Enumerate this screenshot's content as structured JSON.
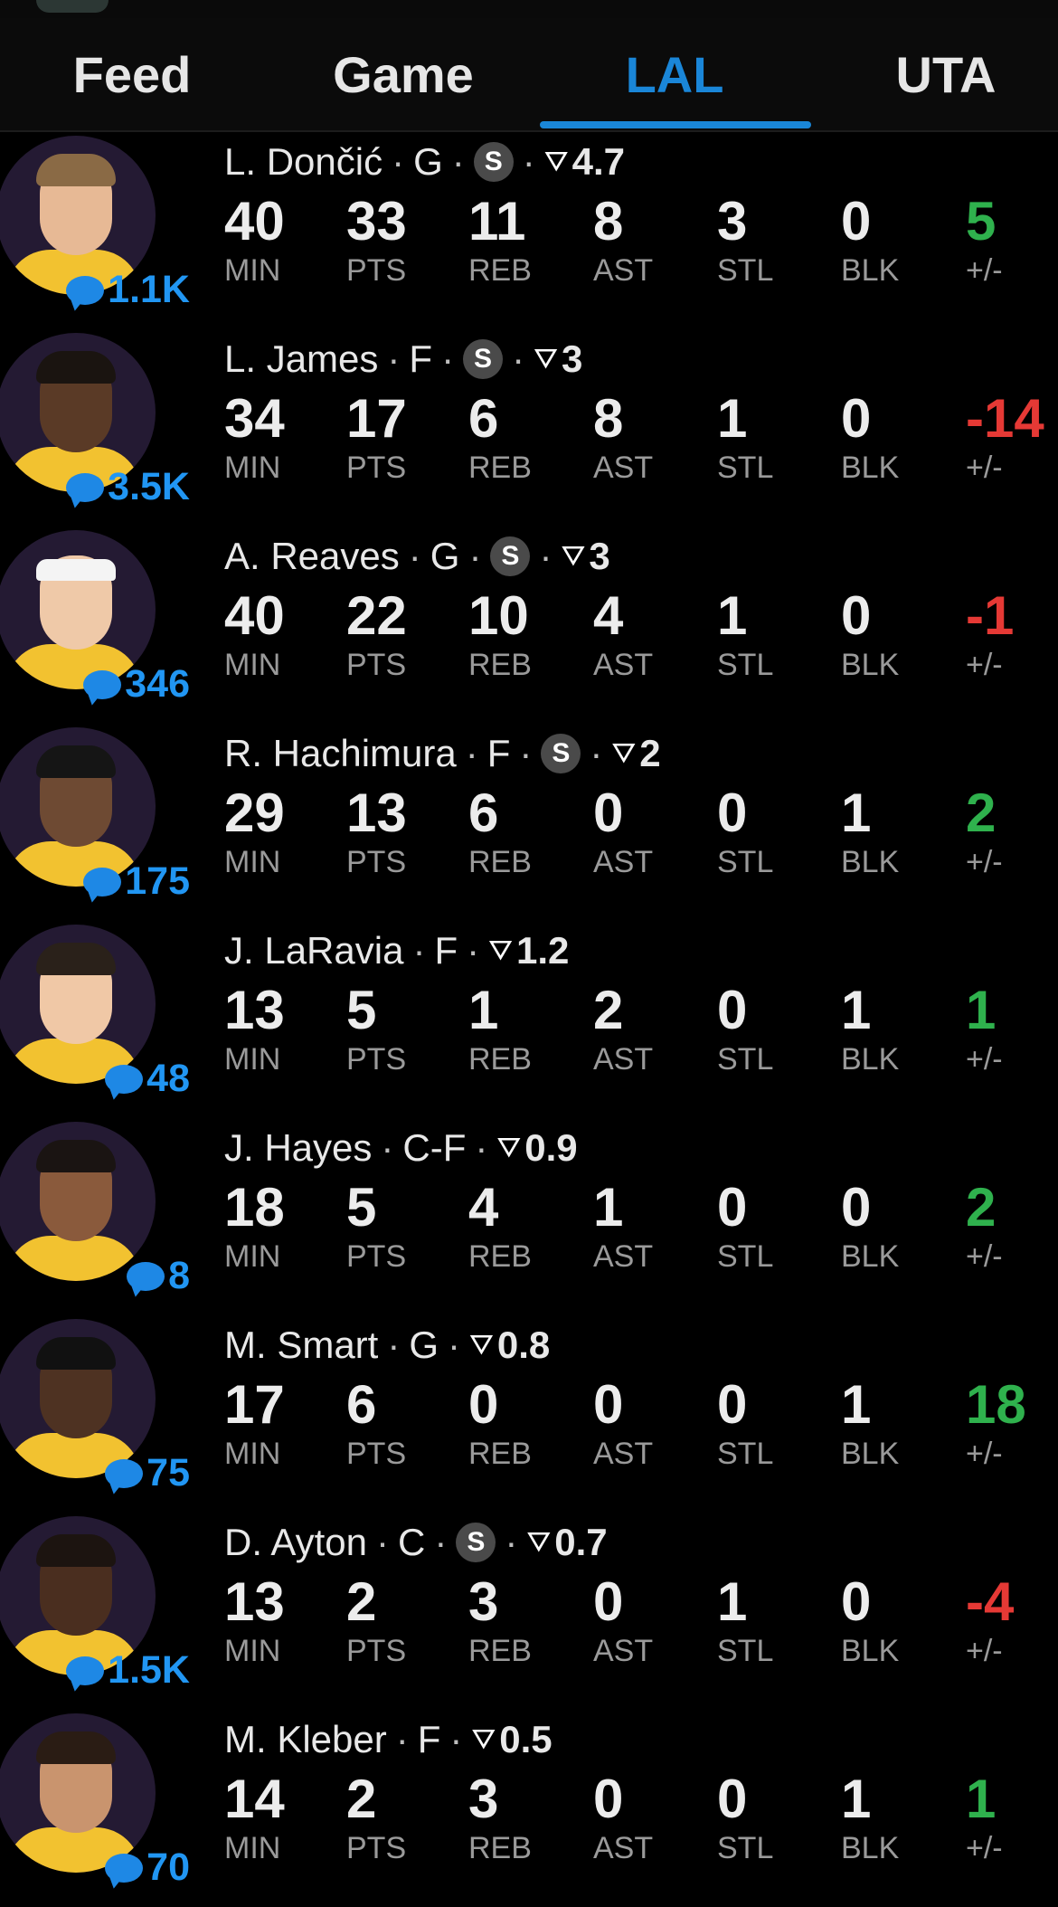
{
  "tabs": [
    {
      "label": "Feed",
      "active": false
    },
    {
      "label": "Game",
      "active": false
    },
    {
      "label": "LAL",
      "active": true
    },
    {
      "label": "UTA",
      "active": false
    }
  ],
  "stat_labels": [
    "MIN",
    "PTS",
    "REB",
    "AST",
    "STL",
    "BLK",
    "+/-"
  ],
  "colors": {
    "accent": "#1a86d8",
    "positive": "#2fb14d",
    "negative": "#e53935",
    "comment": "#2196f3"
  },
  "players": [
    {
      "name": "L. Dončić",
      "pos": "G",
      "starter": true,
      "starter_badge": "S",
      "rating": "4.7",
      "comments": "1.1K",
      "stats": [
        "40",
        "33",
        "11",
        "8",
        "3",
        "0",
        "5"
      ],
      "plus_minus_sign": "positive"
    },
    {
      "name": "L. James",
      "pos": "F",
      "starter": true,
      "starter_badge": "S",
      "rating": "3",
      "comments": "3.5K",
      "stats": [
        "34",
        "17",
        "6",
        "8",
        "1",
        "0",
        "-14"
      ],
      "plus_minus_sign": "negative"
    },
    {
      "name": "A. Reaves",
      "pos": "G",
      "starter": true,
      "starter_badge": "S",
      "rating": "3",
      "comments": "346",
      "stats": [
        "40",
        "22",
        "10",
        "4",
        "1",
        "0",
        "-1"
      ],
      "plus_minus_sign": "negative"
    },
    {
      "name": "R. Hachimura",
      "pos": "F",
      "starter": true,
      "starter_badge": "S",
      "rating": "2",
      "comments": "175",
      "stats": [
        "29",
        "13",
        "6",
        "0",
        "0",
        "1",
        "2"
      ],
      "plus_minus_sign": "positive"
    },
    {
      "name": "J. LaRavia",
      "pos": "F",
      "starter": false,
      "rating": "1.2",
      "comments": "48",
      "stats": [
        "13",
        "5",
        "1",
        "2",
        "0",
        "1",
        "1"
      ],
      "plus_minus_sign": "positive"
    },
    {
      "name": "J. Hayes",
      "pos": "C-F",
      "starter": false,
      "rating": "0.9",
      "comments": "8",
      "stats": [
        "18",
        "5",
        "4",
        "1",
        "0",
        "0",
        "2"
      ],
      "plus_minus_sign": "positive"
    },
    {
      "name": "M. Smart",
      "pos": "G",
      "starter": false,
      "rating": "0.8",
      "comments": "75",
      "stats": [
        "17",
        "6",
        "0",
        "0",
        "0",
        "1",
        "18"
      ],
      "plus_minus_sign": "positive"
    },
    {
      "name": "D. Ayton",
      "pos": "C",
      "starter": true,
      "starter_badge": "S",
      "rating": "0.7",
      "comments": "1.5K",
      "stats": [
        "13",
        "2",
        "3",
        "0",
        "1",
        "0",
        "-4"
      ],
      "plus_minus_sign": "negative"
    },
    {
      "name": "M. Kleber",
      "pos": "F",
      "starter": false,
      "rating": "0.5",
      "comments": "70",
      "stats": [
        "14",
        "2",
        "3",
        "0",
        "0",
        "1",
        "1"
      ],
      "plus_minus_sign": "positive"
    }
  ]
}
